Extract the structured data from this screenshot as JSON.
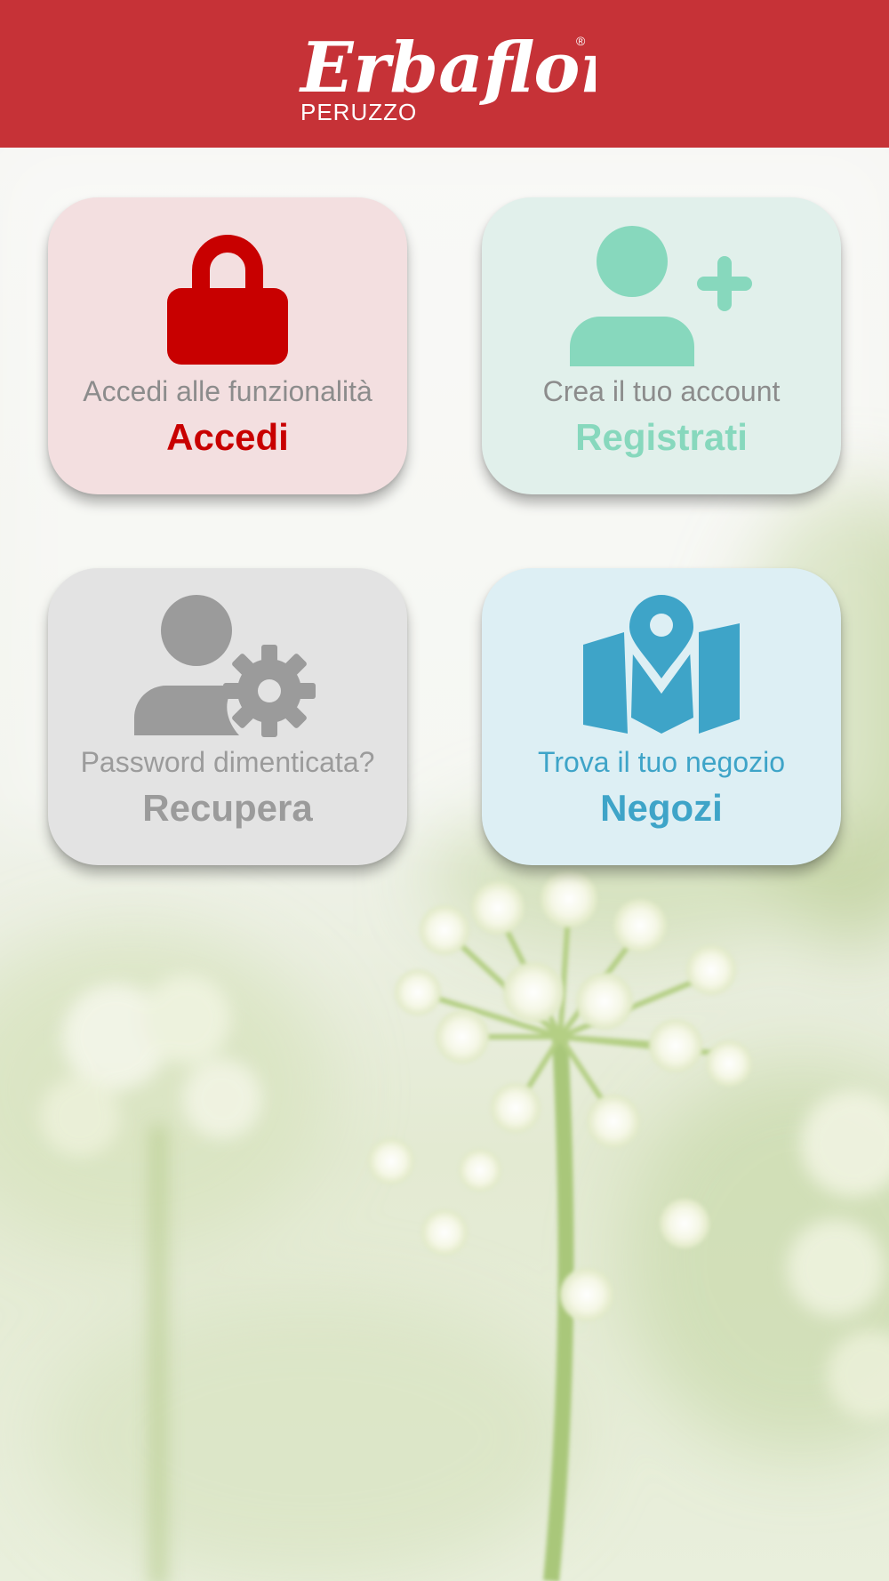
{
  "header": {
    "logo_text": "Erbaflor",
    "logo_subtext": "PERUZZO",
    "logo_registered": "®",
    "background_color": "#c63237"
  },
  "cards": [
    {
      "id": "accedi",
      "icon": "lock-icon",
      "subtitle": "Accedi alle funzionalità",
      "title": "Accedi",
      "background": "#f3dfe0",
      "accent": "#c80000"
    },
    {
      "id": "registrati",
      "icon": "add-user-icon",
      "subtitle": "Crea il tuo account",
      "title": "Registrati",
      "background": "#e1f0eb",
      "accent": "#87d8bd"
    },
    {
      "id": "recupera",
      "icon": "user-gear-icon",
      "subtitle": "Password dimenticata?",
      "title": "Recupera",
      "background": "#e3e3e3",
      "accent": "#9b9b9b"
    },
    {
      "id": "negozi",
      "icon": "map-pin-icon",
      "subtitle": "Trova il tuo negozio",
      "title": "Negozi",
      "background": "#ddeff4",
      "accent": "#3ea4c8"
    }
  ],
  "background": {
    "image": "flower-photo"
  }
}
